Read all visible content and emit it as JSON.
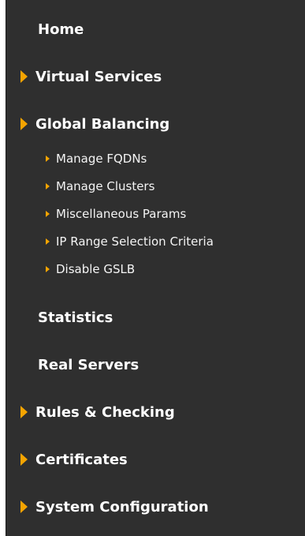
{
  "nav": {
    "items": [
      {
        "label": "Home"
      },
      {
        "label": "Virtual Services"
      },
      {
        "label": "Global Balancing"
      },
      {
        "label": "Statistics"
      },
      {
        "label": "Real Servers"
      },
      {
        "label": "Rules & Checking"
      },
      {
        "label": "Certificates"
      },
      {
        "label": "System Configuration"
      }
    ],
    "global_balancing_children": [
      {
        "label": "Manage FQDNs"
      },
      {
        "label": "Manage Clusters"
      },
      {
        "label": "Miscellaneous Params"
      },
      {
        "label": "IP Range Selection Criteria"
      },
      {
        "label": "Disable GSLB"
      }
    ]
  },
  "colors": {
    "background": "#2f2f2f",
    "accent_arrow": "#f5a400",
    "text": "#ffffff"
  }
}
